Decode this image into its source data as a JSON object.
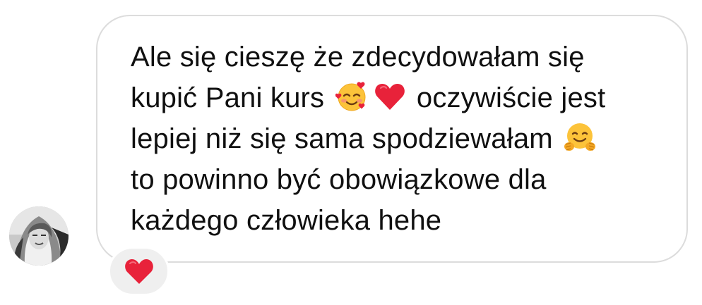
{
  "message": {
    "line1": "Ale się cieszę że zdecydowałam się",
    "line2_start": "kupić Pani kurs",
    "line2_end": "oczywiście jest",
    "line3": "lepiej niż się sama spodziewałam",
    "line4": "to powinno być obowiązkowe dla",
    "line5": "każdego człowieka hehe",
    "emojis": [
      "smiling-face-with-hearts-icon",
      "red-heart-icon",
      "hugging-face-icon"
    ]
  },
  "reaction": {
    "icon": "red-heart-icon",
    "color": "#e8223a"
  },
  "colors": {
    "bubble_border": "#dcdcdc",
    "reaction_bg": "#efefef",
    "text": "#101010"
  }
}
